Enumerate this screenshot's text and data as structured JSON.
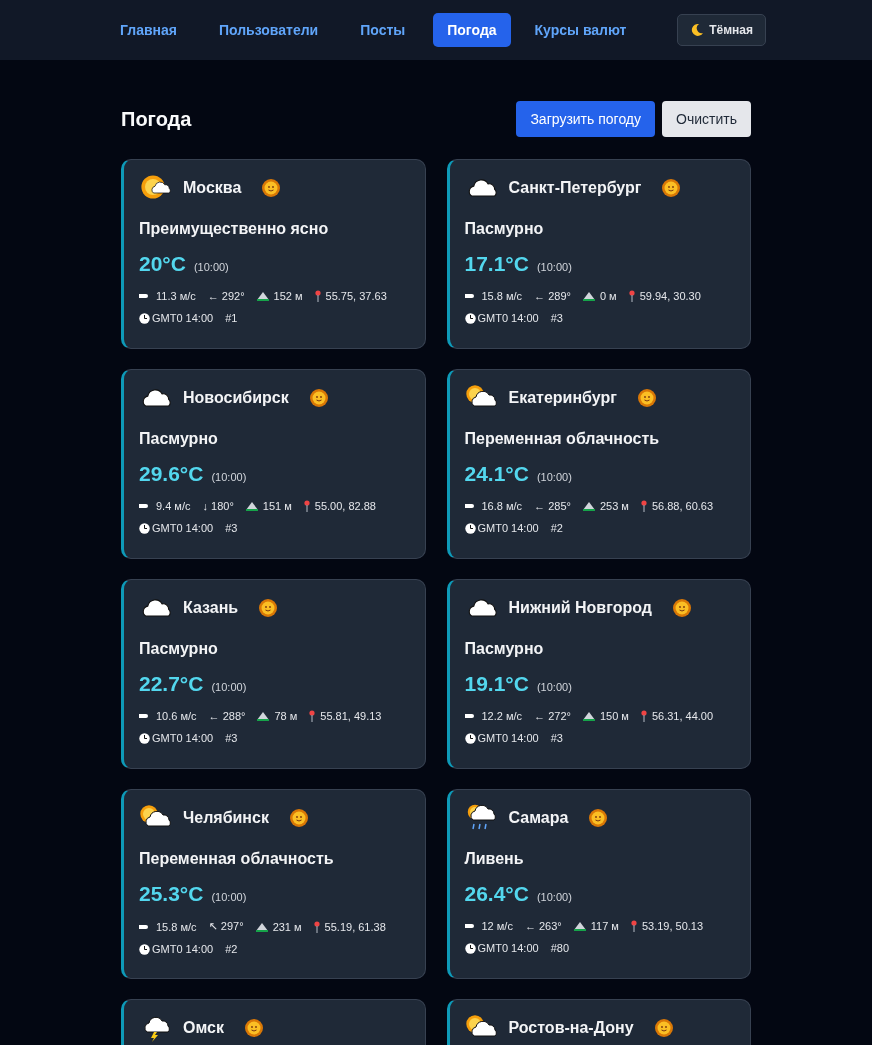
{
  "nav": {
    "items": [
      {
        "label": "Главная",
        "selected": false
      },
      {
        "label": "Пользователи",
        "selected": false
      },
      {
        "label": "Посты",
        "selected": false
      },
      {
        "label": "Погода",
        "selected": true
      },
      {
        "label": "Курсы валют",
        "selected": false
      }
    ],
    "theme_button": "Тёмная"
  },
  "page": {
    "title": "Погода",
    "buttons": [
      {
        "label": "Загрузить погоду",
        "kind": "primary"
      },
      {
        "label": "Очистить",
        "kind": "secondary"
      }
    ]
  },
  "cards": [
    {
      "city": "Москва",
      "kind": "sun-cloud",
      "condition": "Преимущественно ясно",
      "temp": "20°C",
      "time": "(10:00)",
      "wind": "11.3 м/с",
      "direction": "← 292°",
      "elevation": "152 м",
      "coords": "55.75, 37.63",
      "timezone": "GMT0 14:00",
      "code": "#1"
    },
    {
      "city": "Санкт-Петербург",
      "kind": "cloud",
      "condition": "Пасмурно",
      "temp": "17.1°C",
      "time": "(10:00)",
      "wind": "15.8 м/с",
      "direction": "← 289°",
      "elevation": "0 м",
      "coords": "59.94, 30.30",
      "timezone": "GMT0 14:00",
      "code": "#3"
    },
    {
      "city": "Новосибирск",
      "kind": "cloud",
      "condition": "Пасмурно",
      "temp": "29.6°C",
      "time": "(10:00)",
      "wind": "9.4 м/с",
      "direction": "↓ 180°",
      "elevation": "151 м",
      "coords": "55.00, 82.88",
      "timezone": "GMT0 14:00",
      "code": "#3"
    },
    {
      "city": "Екатеринбург",
      "kind": "cloud-sun",
      "condition": "Переменная облачность",
      "temp": "24.1°C",
      "time": "(10:00)",
      "wind": "16.8 м/с",
      "direction": "← 285°",
      "elevation": "253 м",
      "coords": "56.88, 60.63",
      "timezone": "GMT0 14:00",
      "code": "#2"
    },
    {
      "city": "Казань",
      "kind": "cloud",
      "condition": "Пасмурно",
      "temp": "22.7°C",
      "time": "(10:00)",
      "wind": "10.6 м/с",
      "direction": "← 288°",
      "elevation": "78 м",
      "coords": "55.81, 49.13",
      "timezone": "GMT0 14:00",
      "code": "#3"
    },
    {
      "city": "Нижний Новгород",
      "kind": "cloud",
      "condition": "Пасмурно",
      "temp": "19.1°C",
      "time": "(10:00)",
      "wind": "12.2 м/с",
      "direction": "← 272°",
      "elevation": "150 м",
      "coords": "56.31, 44.00",
      "timezone": "GMT0 14:00",
      "code": "#3"
    },
    {
      "city": "Челябинск",
      "kind": "cloud-sun",
      "condition": "Переменная облачность",
      "temp": "25.3°C",
      "time": "(10:00)",
      "wind": "15.8 м/с",
      "direction": "↖ 297°",
      "elevation": "231 м",
      "coords": "55.19, 61.38",
      "timezone": "GMT0 14:00",
      "code": "#2"
    },
    {
      "city": "Самара",
      "kind": "rain",
      "condition": "Ливень",
      "temp": "26.4°C",
      "time": "(10:00)",
      "wind": "12 м/с",
      "direction": "← 263°",
      "elevation": "117 м",
      "coords": "53.19, 50.13",
      "timezone": "GMT0 14:00",
      "code": "#80"
    },
    {
      "city": "Омск",
      "kind": "storm"
    },
    {
      "city": "Ростов-на-Дону",
      "kind": "cloud-sun"
    }
  ]
}
